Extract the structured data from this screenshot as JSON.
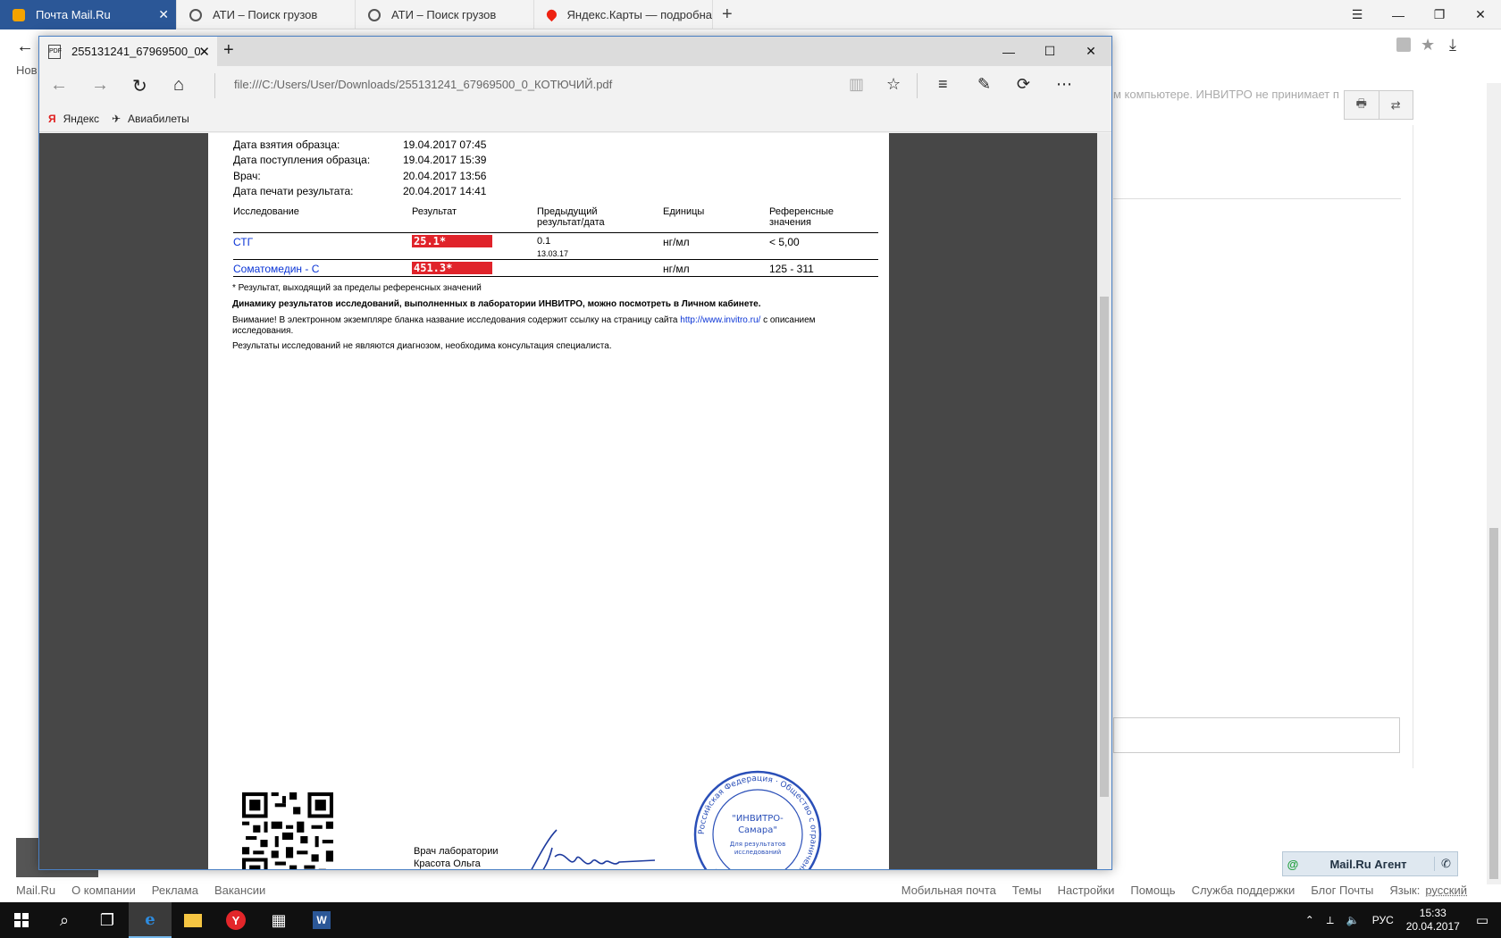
{
  "outer_browser": {
    "tabs": [
      {
        "title": "Почта Mail.Ru",
        "active": true
      },
      {
        "title": "АТИ – Поиск грузов",
        "active": false
      },
      {
        "title": "АТИ – Поиск грузов",
        "active": false
      },
      {
        "title": "Яндекс.Карты — подробна",
        "active": false
      }
    ],
    "nav_short": "Нов",
    "notice": "м компьютере. ИНВИТРО не принимает п",
    "agent": {
      "label": "Mail.Ru Агент",
      "at": "@"
    },
    "footer_left": [
      "Mail.Ru",
      "О компании",
      "Реклама",
      "Вакансии"
    ],
    "footer_right": [
      "Мобильная почта",
      "Темы",
      "Настройки",
      "Помощь",
      "Служба поддержки",
      "Блог Почты",
      "Язык:"
    ],
    "language": "русский"
  },
  "edge": {
    "tab_title": "255131241_67969500_0",
    "pdf_badge": "PDF",
    "url": "file:///C:/Users/User/Downloads/255131241_67969500_0_КОТЮЧИЙ.pdf",
    "favorites": [
      {
        "label": "Яндекс",
        "icon": "yandex-icon"
      },
      {
        "label": "Авиабилеты",
        "icon": "plane-icon"
      }
    ]
  },
  "document": {
    "meta": [
      {
        "key": "Дата взятия образца:",
        "value": "19.04.2017 07:45"
      },
      {
        "key": "Дата поступления образца:",
        "value": "19.04.2017 15:39"
      },
      {
        "key": "Врач:",
        "value": "20.04.2017 13:56"
      },
      {
        "key": "Дата печати результата:",
        "value": "20.04.2017 14:41"
      }
    ],
    "columns": {
      "study": "Исследование",
      "result": "Результат",
      "previous_l1": "Предыдущий",
      "previous_l2": "результат/дата",
      "units": "Единицы",
      "reference": "Референсные значения"
    },
    "rows": [
      {
        "name": "СТГ",
        "result": "25.1*",
        "previous": "0.1",
        "previous_date": "13.03.17",
        "units": "нг/мл",
        "reference": "< 5,00"
      },
      {
        "name": "Соматомедин - С",
        "result": "451.3*",
        "previous": "",
        "previous_date": "",
        "units": "нг/мл",
        "reference": "125 - 311"
      }
    ],
    "footnote": "* Результат, выходящий за пределы референсных значений",
    "dynamics": "Динамику результатов исследований, выполненных в лаборатории ИНВИТРО, можно посмотреть в Личном кабинете.",
    "attention_pre": "Внимание! В электронном экземпляре бланка название исследования содержит ссылку на страницу сайта",
    "attention_link": "http://www.invitro.ru/",
    "attention_post": "с описанием исследования.",
    "disclaimer": "Результаты исследований не являются диагнозом, необходима консультация специалиста.",
    "doctor_label": "Врач лаборатории",
    "doctor_name": "Красота Ольга",
    "stamp_center_1": "\"ИНВИТРО-",
    "stamp_center_2": "Самара\"",
    "stamp_center_3": "Для результатов",
    "stamp_center_4": "исследований",
    "stamp_ring": "Российская Федерация · Общество с ограниченной ответственностью"
  },
  "taskbar": {
    "lang": "РУС",
    "time": "15:33",
    "date": "20.04.2017"
  },
  "colors": {
    "accent": "#2b5797",
    "result_flag": "#e0232a",
    "link": "#0a34d6",
    "stamp": "#2a4fb8"
  }
}
